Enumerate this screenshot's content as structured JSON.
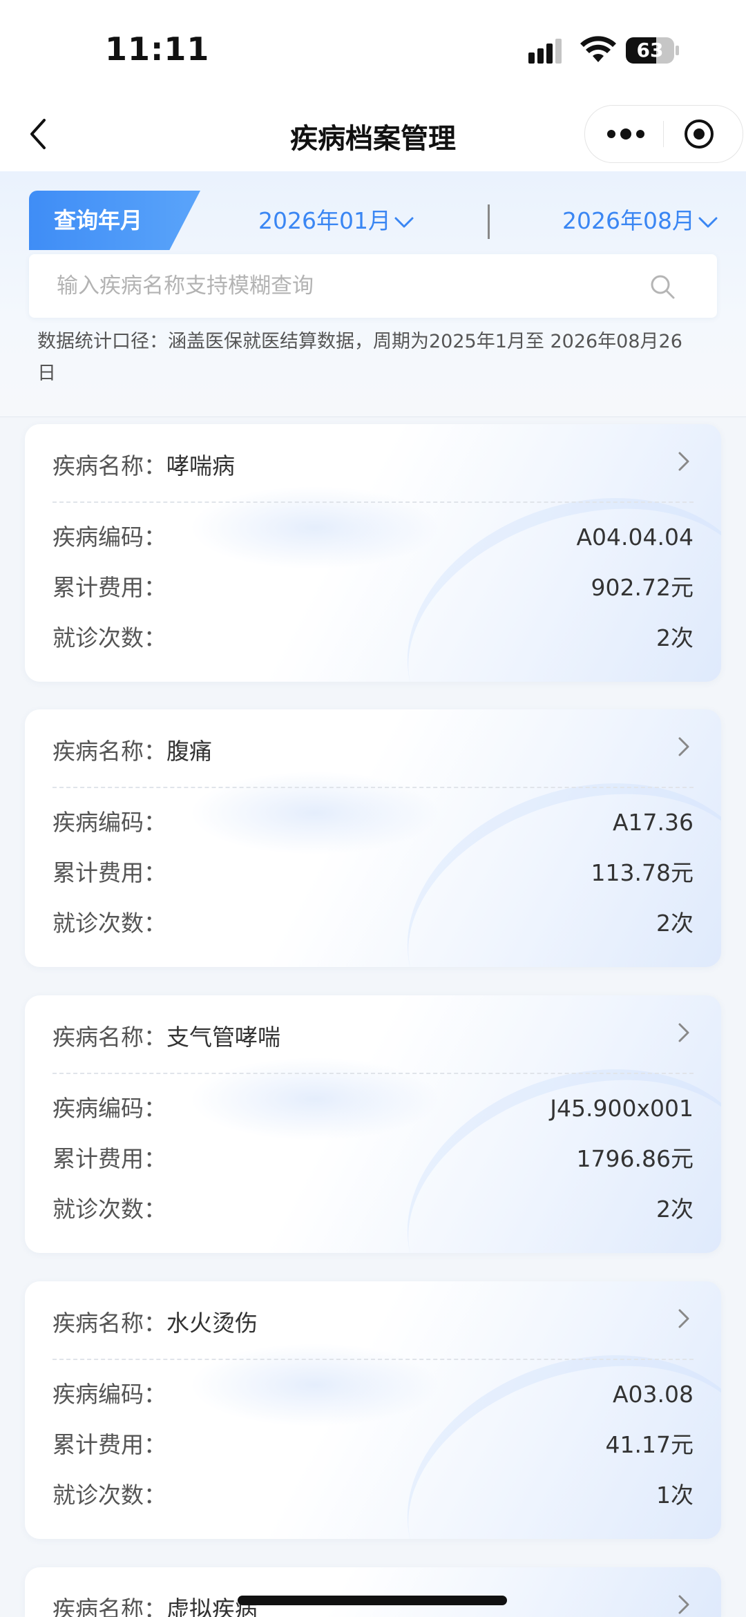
{
  "status_bar": {
    "time": "11:11",
    "battery_level": "63"
  },
  "nav": {
    "title": "疾病档案管理"
  },
  "filter": {
    "query_label": "查询年月",
    "start_date": "2026年01月",
    "end_date": "2026年08月",
    "search_placeholder": "输入疾病名称支持模糊查询",
    "search_value": "",
    "stat_note": "数据统计口径：涵盖医保就医结算数据，周期为2025年1月至 2026年08月26日"
  },
  "labels": {
    "name": "疾病名称：",
    "code": "疾病编码：",
    "cost": "累计费用：",
    "visits": "就诊次数："
  },
  "cards": [
    {
      "name": "哮喘病",
      "code": "A04.04.04",
      "cost": "902.72元",
      "visits": "2次"
    },
    {
      "name": "腹痛",
      "code": "A17.36",
      "cost": "113.78元",
      "visits": "2次"
    },
    {
      "name": "支气管哮喘",
      "code": "J45.900x001",
      "cost": "1796.86元",
      "visits": "2次"
    },
    {
      "name": "水火烫伤",
      "code": "A03.08",
      "cost": "41.17元",
      "visits": "1次"
    },
    {
      "name": "虚拟疾病"
    }
  ],
  "colors": {
    "accent": "#3a86f3",
    "tab_gradient_start": "#3f8df6",
    "tab_gradient_end": "#5aa4fa",
    "background": "#f3f6fa"
  }
}
